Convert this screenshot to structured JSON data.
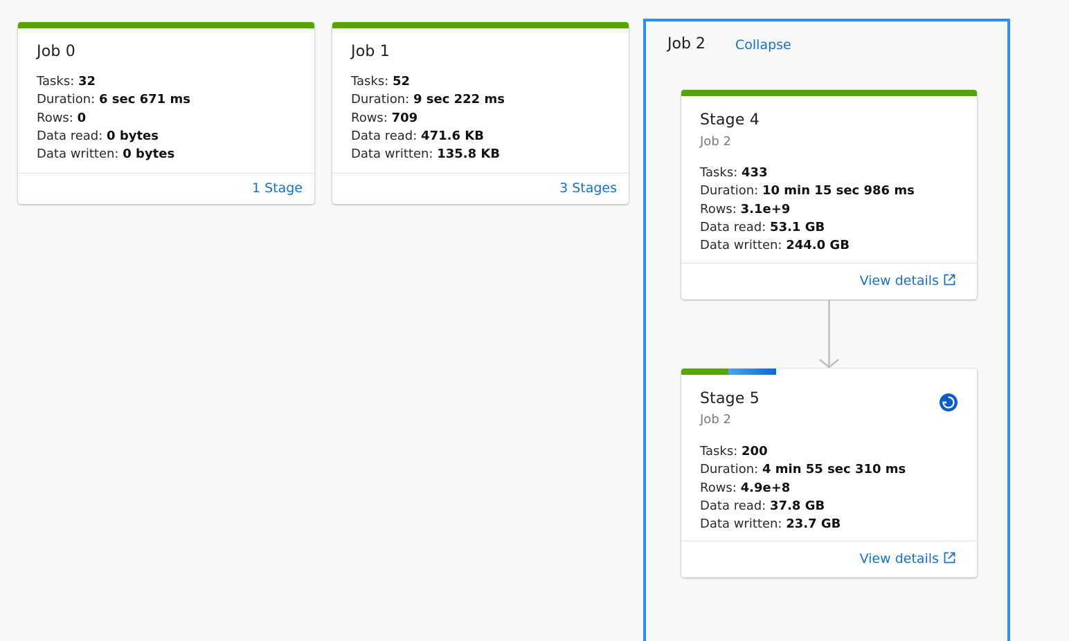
{
  "jobs": [
    {
      "title": "Job 0",
      "metrics": {
        "tasks_label": "Tasks:",
        "tasks": "32",
        "duration_label": "Duration:",
        "duration": "6 sec 671 ms",
        "rows_label": "Rows:",
        "rows": "0",
        "read_label": "Data read:",
        "read": "0 bytes",
        "written_label": "Data written:",
        "written": "0 bytes"
      },
      "footer_link": "1 Stage",
      "status_color": "#57a300"
    },
    {
      "title": "Job 1",
      "metrics": {
        "tasks_label": "Tasks:",
        "tasks": "52",
        "duration_label": "Duration:",
        "duration": "9 sec 222 ms",
        "rows_label": "Rows:",
        "rows": "709",
        "read_label": "Data read:",
        "read": "471.6 KB",
        "written_label": "Data written:",
        "written": "135.8 KB"
      },
      "footer_link": "3 Stages",
      "status_color": "#57a300"
    }
  ],
  "job2": {
    "title": "Job 2",
    "collapse_label": "Collapse",
    "frame_color": "#2e8ff0",
    "stages": [
      {
        "title": "Stage 4",
        "job": "Job 2",
        "metrics": {
          "tasks_label": "Tasks:",
          "tasks": "433",
          "duration_label": "Duration:",
          "duration": "10 min 15 sec 986 ms",
          "rows_label": "Rows:",
          "rows": "3.1e+9",
          "read_label": "Data read:",
          "read": "53.1 GB",
          "written_label": "Data written:",
          "written": "244.0 GB"
        },
        "footer_link": "View details",
        "footer_icon": "external-link-icon",
        "progress": {
          "succeeded_fraction": 1.0
        }
      },
      {
        "title": "Stage 5",
        "job": "Job 2",
        "metrics": {
          "tasks_label": "Tasks:",
          "tasks": "200",
          "duration_label": "Duration:",
          "duration": "4 min 55 sec 310 ms",
          "rows_label": "Rows:",
          "rows": "4.9e+8",
          "read_label": "Data read:",
          "read": "37.8 GB",
          "written_label": "Data written:",
          "written": "23.7 GB"
        },
        "footer_link": "View details",
        "footer_icon": "external-link-icon",
        "status_icon": "running-icon",
        "progress": {
          "succeeded_fraction": 0.16,
          "running_fraction": 0.16
        }
      }
    ]
  },
  "colors": {
    "succeeded": "#57a300",
    "running": "#0b6bd1",
    "link": "#1473c8"
  }
}
